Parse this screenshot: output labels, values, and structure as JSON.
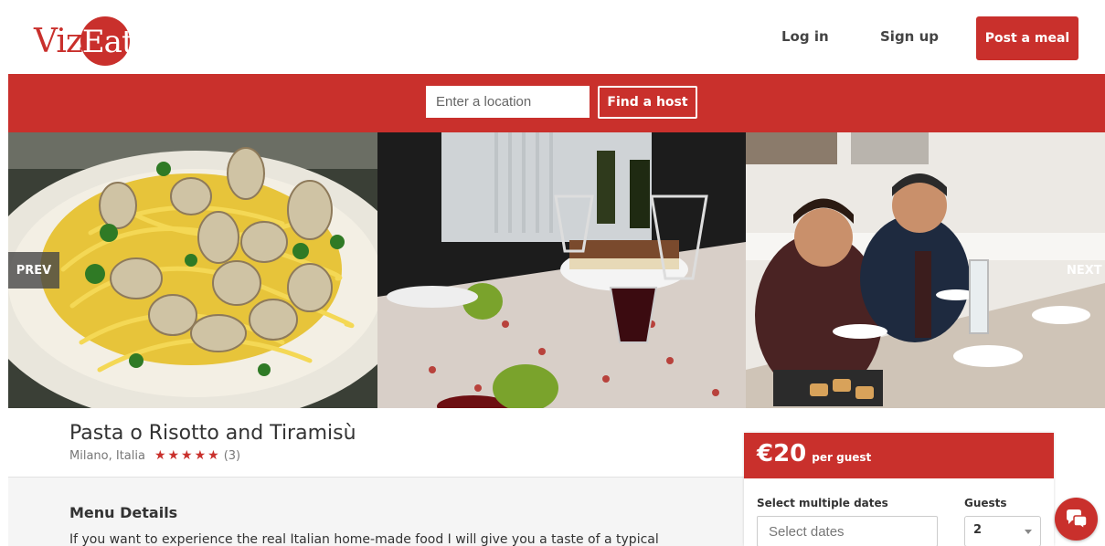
{
  "header": {
    "logo_left": "Viz",
    "logo_right": "Eat",
    "login_label": "Log in",
    "signup_label": "Sign up",
    "post_meal_label": "Post a meal"
  },
  "search": {
    "location_placeholder": "Enter a location",
    "find_host_label": "Find a host"
  },
  "gallery": {
    "prev_label": "PREV",
    "next_label": "NEXT"
  },
  "meal": {
    "title": "Pasta o Risotto and Tiramisù",
    "location": "Milano, Italia",
    "stars": "★★★★★",
    "review_count": "(3)",
    "menu_heading": "Menu Details",
    "menu_description": "If you want to experience the real Italian home-made food I will give you a taste of a typical"
  },
  "booking": {
    "price": "€20",
    "per_guest": "per guest",
    "dates_label": "Select multiple dates",
    "dates_placeholder": "Select dates",
    "guests_label": "Guests",
    "guests_value": "2"
  },
  "colors": {
    "brand_red": "#c9302c"
  },
  "icons": {
    "chat": "chat-bubbles-icon",
    "guests_caret": "chevron-down-icon"
  }
}
